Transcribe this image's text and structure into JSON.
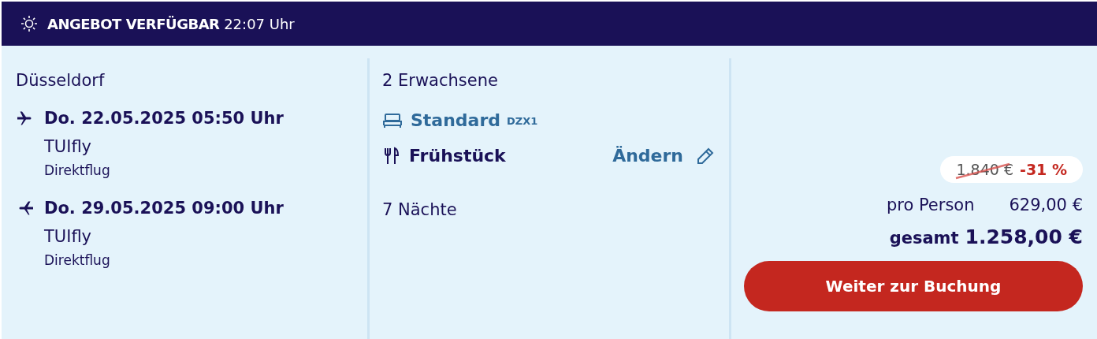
{
  "banner": {
    "title": "ANGEBOT VERFÜGBAR",
    "time": "22:07 Uhr"
  },
  "travel": {
    "departure_city": "Düsseldorf",
    "flights": [
      {
        "kind": "outbound",
        "datetime": "Do. 22.05.2025 05:50 Uhr",
        "airline": "TUIfly",
        "type": "Direktflug"
      },
      {
        "kind": "return",
        "datetime": "Do. 29.05.2025 09:00 Uhr",
        "airline": "TUIfly",
        "type": "Direktflug"
      }
    ]
  },
  "stay": {
    "travellers": "2 Erwachsene",
    "room": {
      "name": "Standard",
      "code": "DZX1"
    },
    "board": {
      "name": "Frühstück",
      "change_link": "Ändern"
    },
    "nights": "7 Nächte"
  },
  "price": {
    "old_price": "1.840 €",
    "discount": "-31 %",
    "per_person_label": "pro Person",
    "per_person": "629,00 €",
    "total_label": "gesamt",
    "total": "1.258,00 €",
    "book_button": "Weiter zur Buchung"
  }
}
